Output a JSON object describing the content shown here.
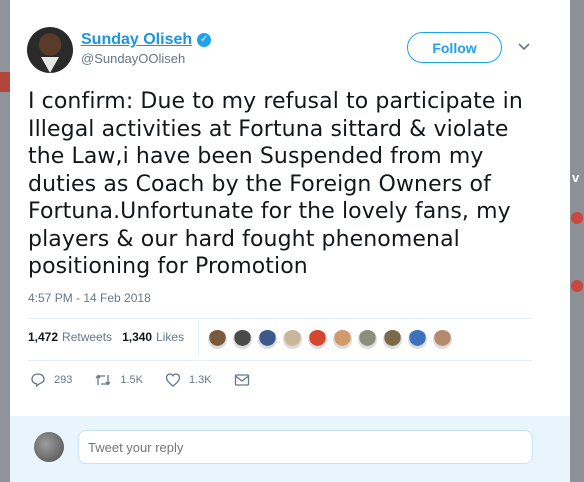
{
  "profile": {
    "display_name": "Sunday Oliseh",
    "handle": "@SundayOOliseh",
    "verified_icon": "verified-badge-icon"
  },
  "follow_button": {
    "label": "Follow"
  },
  "tweet": {
    "lines": [
      "I confirm: Due to my refusal to participate in",
      "Illegal activities at Fortuna sittard & violate",
      "the Law,i have been Suspended from my",
      "duties as Coach by the Foreign Owners of",
      "Fortuna.Unfortunate for the lovely fans, my",
      "players & our hard fought phenomenal",
      "positioning for Promotion"
    ],
    "timestamp": "4:57 PM - 14 Feb 2018"
  },
  "stats": {
    "retweets_count": "1,472",
    "retweets_label": "Retweets",
    "likes_count": "1,340",
    "likes_label": "Likes"
  },
  "likers": {
    "colors": [
      "#7a5a3c",
      "#4a4a4a",
      "#3b5a8a",
      "#c8b79a",
      "#d6452f",
      "#d09a6a",
      "#8b8f7a",
      "#7a6a4a",
      "#3a73b9",
      "#b58a6a"
    ]
  },
  "actions": {
    "reply_count": "293",
    "retweet_count": "1.5K",
    "like_count": "1.3K"
  },
  "reply": {
    "placeholder": "Tweet your reply"
  },
  "colors": {
    "accent": "#1da1f2",
    "link": "#1b95e0",
    "reply_bar": "#e8f5fd"
  }
}
